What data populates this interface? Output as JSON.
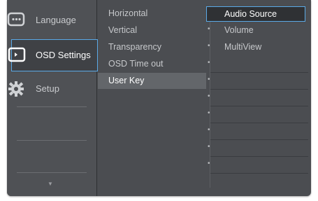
{
  "left_menu": {
    "items": [
      {
        "label": "Language",
        "icon": "speech-bubble-icon"
      },
      {
        "label": "OSD Settings",
        "icon": "monitor-osd-icon"
      },
      {
        "label": "Setup",
        "icon": "gear-icon"
      }
    ],
    "selected_index": 1,
    "more_indicator": "▼"
  },
  "middle_menu": {
    "items": [
      "Horizontal",
      "Vertical",
      "Transparency",
      "OSD Time out",
      "User Key"
    ],
    "selected_index": 4,
    "bullet": "•"
  },
  "right_menu": {
    "items": [
      "Audio Source",
      "Volume",
      "MultiView"
    ],
    "selected_index": 0
  },
  "colors": {
    "frame_bg": "#4b4d51",
    "highlight_outline": "#5aa9e6",
    "text": "#c6c8cb",
    "text_selected": "#ffffff"
  }
}
